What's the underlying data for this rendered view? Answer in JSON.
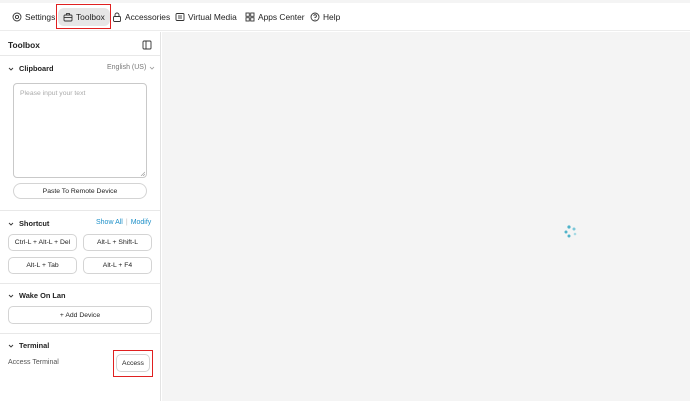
{
  "menu": {
    "settings": "Settings",
    "toolbox": "Toolbox",
    "accessories": "Accessories",
    "virtual_media": "Virtual Media",
    "apps_center": "Apps Center",
    "help": "Help"
  },
  "sidebar": {
    "title": "Toolbox",
    "clipboard": {
      "title": "Clipboard",
      "language": "English (US)",
      "placeholder": "Please input your text",
      "paste_button": "Paste To Remote Device"
    },
    "shortcut": {
      "title": "Shortcut",
      "show_all": "Show All",
      "modify": "Modify",
      "keys": [
        "Ctrl-L + Alt-L + Del",
        "Alt-L + Shift-L",
        "Alt-L + Tab",
        "Alt-L + F4"
      ]
    },
    "wake_on_lan": {
      "title": "Wake On Lan",
      "add_button": "+ Add Device"
    },
    "terminal": {
      "title": "Terminal",
      "label": "Access Terminal",
      "access_button": "Access"
    }
  },
  "colors": {
    "highlight": "#e02020",
    "link": "#1e90c8",
    "spinner": "#4fb3c9"
  },
  "icons": [
    "settings-icon",
    "toolbox-icon",
    "accessories-icon",
    "virtual-media-icon",
    "apps-center-icon",
    "help-icon",
    "sidebar-collapse-icon",
    "chevron-down-icon",
    "loading-spinner-icon"
  ]
}
